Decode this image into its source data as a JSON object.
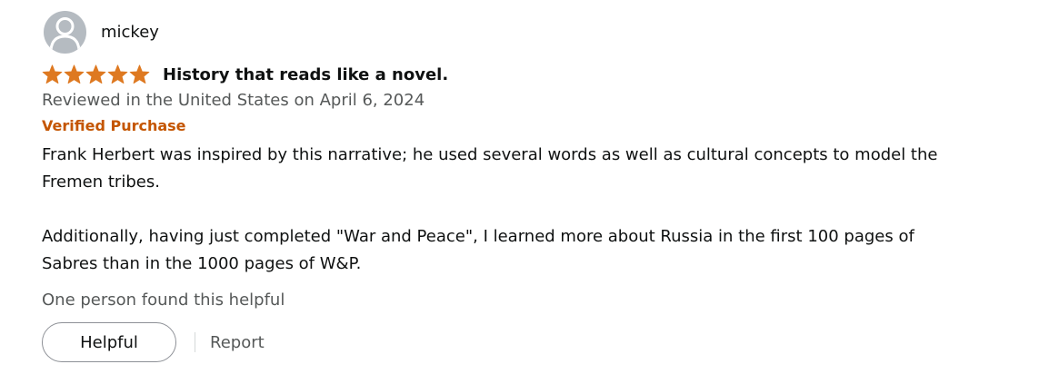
{
  "review": {
    "profile": {
      "name": "mickey",
      "avatar_icon": "default-user-avatar-icon"
    },
    "rating": {
      "stars": 5,
      "max": 5,
      "color": "#de7921"
    },
    "title": "History that reads like a novel.",
    "date_line": "Reviewed in the United States on April 6, 2024",
    "verified_label": "Verified Purchase",
    "body": {
      "paragraph_1": "Frank Herbert was inspired by this narrative; he used several words as well as cultural concepts to model the Fremen tribes.",
      "paragraph_2": "Additionally, having just completed \"War and Peace\", I learned more about Russia in the first 100 pages of Sabres than in the 1000 pages of W&P."
    },
    "helpful_count_text": "One person found this helpful",
    "actions": {
      "helpful_label": "Helpful",
      "report_label": "Report"
    }
  }
}
